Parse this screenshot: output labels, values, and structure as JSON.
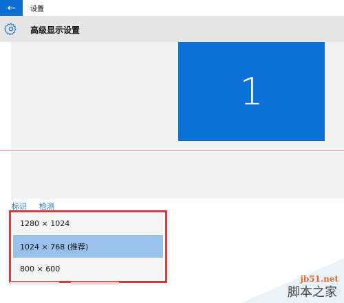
{
  "window": {
    "title": "设置",
    "back_icon": "arrow-left-icon"
  },
  "header": {
    "title": "高级显示设置",
    "icon": "gear-icon"
  },
  "display_preview": {
    "monitor_label": "1",
    "monitor_color": "#0a72d8"
  },
  "links": {
    "identify": "标识",
    "detect": "检测"
  },
  "resolution_dropdown": {
    "options": [
      "1280 × 1024",
      "1024 × 768 (推荐)",
      "800 × 600"
    ],
    "selected": "1024 × 768 (推荐)"
  },
  "watermark": {
    "domain": "jb51.net",
    "name": "脚本之家"
  },
  "colors": {
    "accent": "#0a6fd3",
    "highlight": "#99c2ea",
    "red_border": "#dc3b40"
  }
}
